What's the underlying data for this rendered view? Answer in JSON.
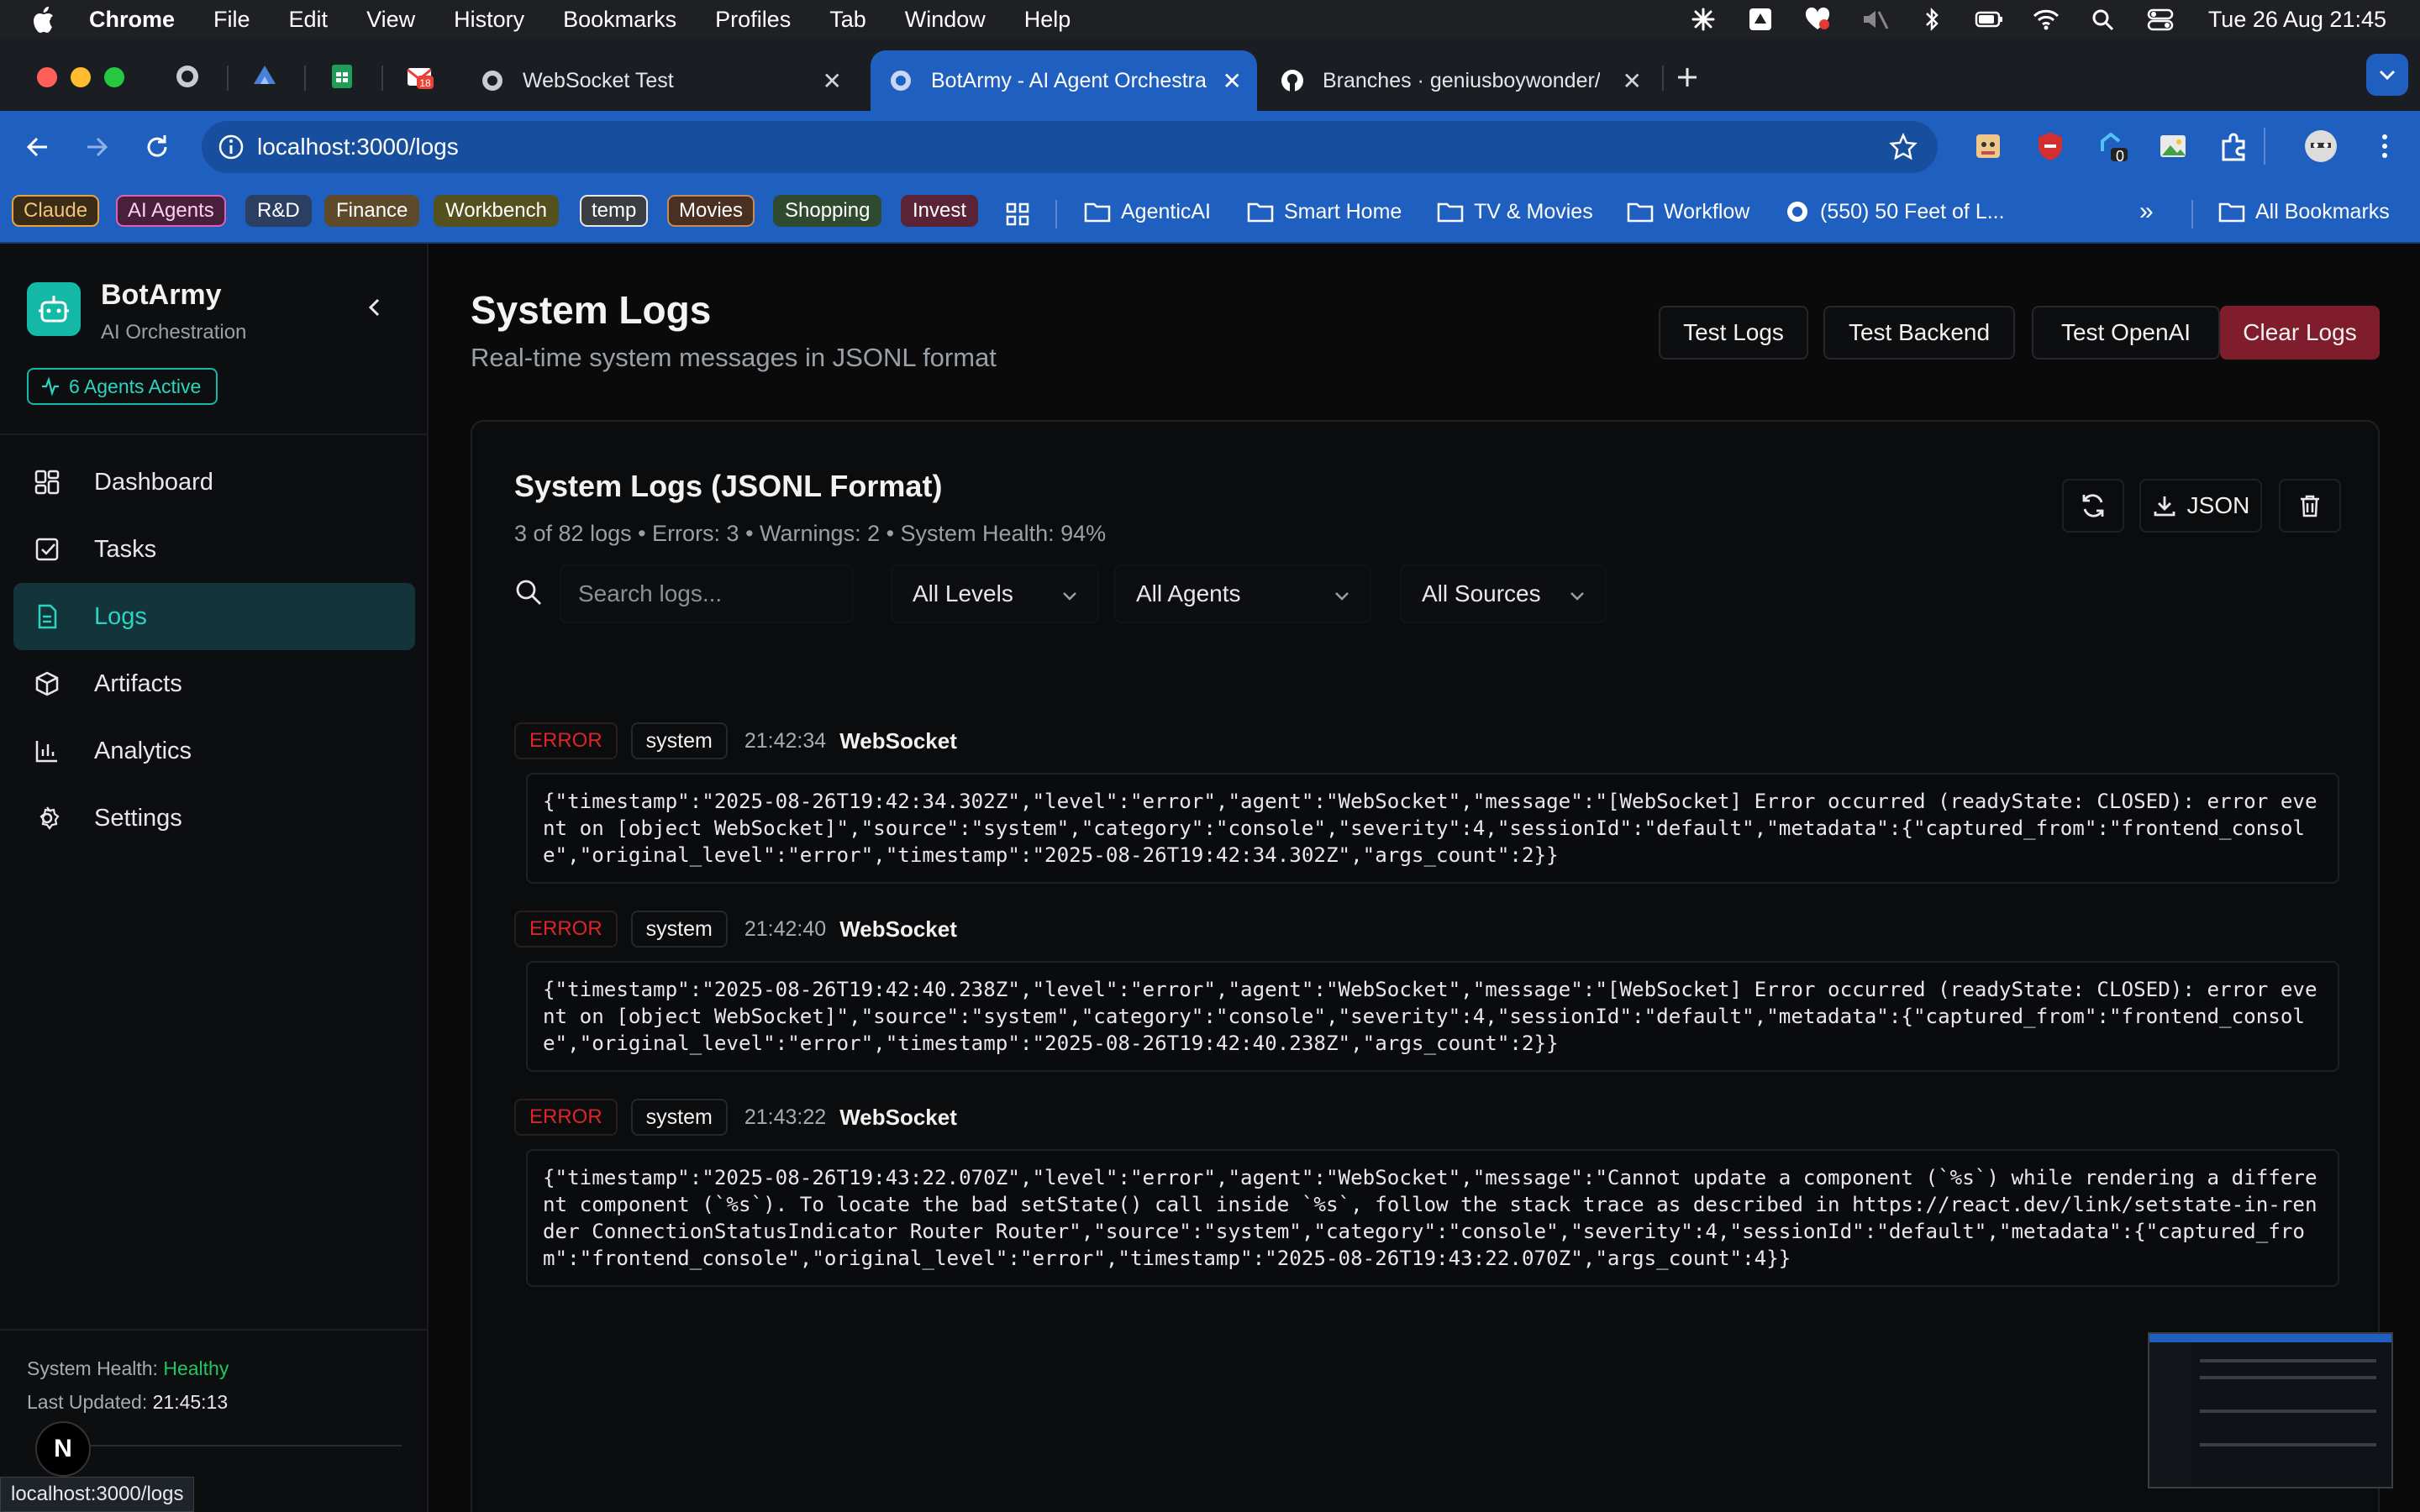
{
  "menubar": {
    "app": "Chrome",
    "items": [
      "File",
      "Edit",
      "View",
      "History",
      "Bookmarks",
      "Profiles",
      "Tab",
      "Window",
      "Help"
    ],
    "clock": "Tue 26 Aug  21:45"
  },
  "tabs": [
    {
      "title": "WebSocket Test",
      "active": false
    },
    {
      "title": "BotArmy - AI Agent Orchestra",
      "active": true
    },
    {
      "title": "Branches · geniusboywonder/",
      "active": false
    }
  ],
  "toolbar": {
    "url": "localhost:3000/logs",
    "extension_badge": "0"
  },
  "bookmarks": {
    "chips": [
      {
        "label": "Claude",
        "color": "#e9a23b"
      },
      {
        "label": "AI Agents",
        "color": "#e25fb0"
      },
      {
        "label": "R&D",
        "color": "#8ab4f8"
      },
      {
        "label": "Finance",
        "color": "#c29a57"
      },
      {
        "label": "Workbench",
        "color": "#b8b060"
      },
      {
        "label": "temp",
        "color": "#e6e6e6"
      },
      {
        "label": "Movies",
        "color": "#c48a5a"
      },
      {
        "label": "Shopping",
        "color": "#6aa36a"
      },
      {
        "label": "Invest",
        "color": "#c0506a"
      }
    ],
    "folders": [
      "AgenticAI",
      "Smart Home",
      "TV & Movies",
      "Workflow"
    ],
    "site": "(550) 50 Feet of L...",
    "overflow": "»",
    "all": "All Bookmarks"
  },
  "sidebar": {
    "brand": "BotArmy",
    "subtitle": "AI Orchestration",
    "agents_badge": "6 Agents Active",
    "nav": [
      {
        "label": "Dashboard",
        "icon": "grid-icon"
      },
      {
        "label": "Tasks",
        "icon": "checkbox-icon"
      },
      {
        "label": "Logs",
        "icon": "file-text-icon",
        "active": true
      },
      {
        "label": "Artifacts",
        "icon": "package-icon"
      },
      {
        "label": "Analytics",
        "icon": "bar-chart-icon"
      },
      {
        "label": "Settings",
        "icon": "gear-icon"
      }
    ],
    "health_label": "System Health:",
    "health_value": "Healthy",
    "updated_label": "Last Updated:",
    "updated_value": "21:45:13",
    "n_badge": "N"
  },
  "status_url": "localhost:3000/logs",
  "page": {
    "title": "System Logs",
    "subtitle": "Real-time system messages in JSONL format",
    "buttons": [
      "Test Logs",
      "Test Backend",
      "Test OpenAI",
      "Clear Logs"
    ]
  },
  "card": {
    "title": "System Logs (JSONL Format)",
    "stats": "3 of 82 logs • Errors: 3 • Warnings: 2 • System Health: 94%",
    "json_label": "JSON",
    "search_placeholder": "Search logs...",
    "filters": [
      "All Levels",
      "All Agents",
      "All Sources"
    ]
  },
  "logs": [
    {
      "level": "ERROR",
      "source": "system",
      "time": "21:42:34",
      "agent": "WebSocket",
      "body": "{\"timestamp\":\"2025-08-26T19:42:34.302Z\",\"level\":\"error\",\"agent\":\"WebSocket\",\"message\":\"[WebSocket] Error occurred (readyState: CLOSED): error event on [object WebSocket]\",\"source\":\"system\",\"category\":\"console\",\"severity\":4,\"sessionId\":\"default\",\"metadata\":{\"captured_from\":\"frontend_console\",\"original_level\":\"error\",\"timestamp\":\"2025-08-26T19:42:34.302Z\",\"args_count\":2}}"
    },
    {
      "level": "ERROR",
      "source": "system",
      "time": "21:42:40",
      "agent": "WebSocket",
      "body": "{\"timestamp\":\"2025-08-26T19:42:40.238Z\",\"level\":\"error\",\"agent\":\"WebSocket\",\"message\":\"[WebSocket] Error occurred (readyState: CLOSED): error event on [object WebSocket]\",\"source\":\"system\",\"category\":\"console\",\"severity\":4,\"sessionId\":\"default\",\"metadata\":{\"captured_from\":\"frontend_console\",\"original_level\":\"error\",\"timestamp\":\"2025-08-26T19:42:40.238Z\",\"args_count\":2}}"
    },
    {
      "level": "ERROR",
      "source": "system",
      "time": "21:43:22",
      "agent": "WebSocket",
      "body": "{\"timestamp\":\"2025-08-26T19:43:22.070Z\",\"level\":\"error\",\"agent\":\"WebSocket\",\"message\":\"Cannot update a component (`%s`) while rendering a different component (`%s`). To locate the bad setState() call inside `%s`, follow the stack trace as described in https://react.dev/link/setstate-in-render ConnectionStatusIndicator Router Router\",\"source\":\"system\",\"category\":\"console\",\"severity\":4,\"sessionId\":\"default\",\"metadata\":{\"captured_from\":\"frontend_console\",\"original_level\":\"error\",\"timestamp\":\"2025-08-26T19:43:22.070Z\",\"args_count\":4}}"
    }
  ]
}
